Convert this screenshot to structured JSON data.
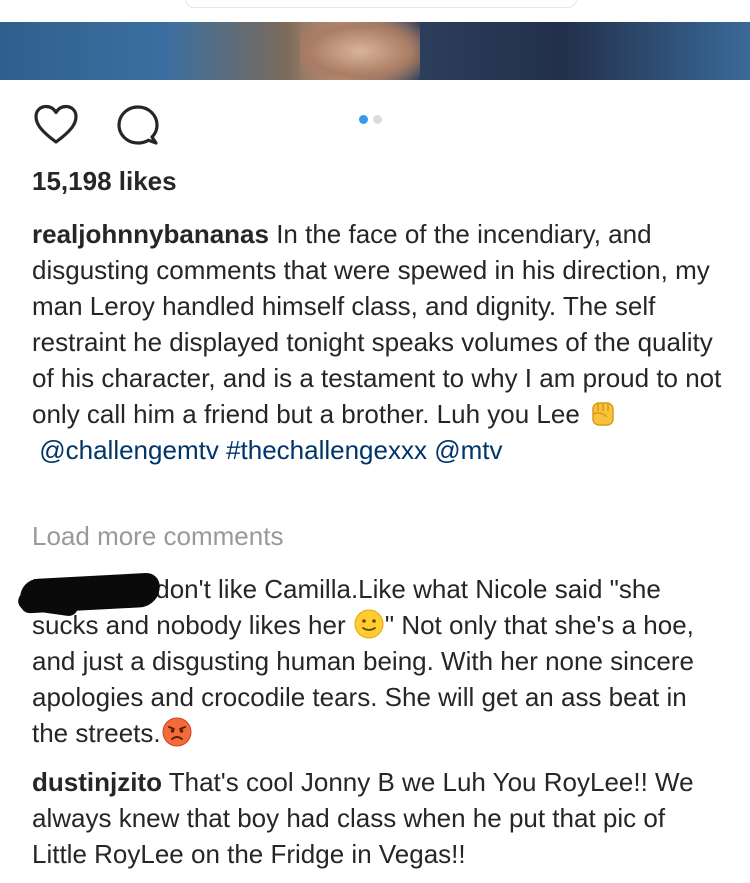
{
  "post": {
    "likes": "15,198 likes",
    "caption": {
      "username": "realjohnnybananas",
      "text": "In the face of the incendiary, and disgusting comments that were spewed in his direction, my man Leroy handled himself class, and dignity. The self restraint he displayed tonight speaks volumes of the quality of his character, and is a testament to why I am proud to not only call him a friend but a brother. Luh you Lee",
      "emoji": "raised-fist-emoji",
      "mention1": "@challengemtv",
      "hashtag": "#thechallengexxx",
      "mention2": "@mtv"
    },
    "carousel": {
      "count": 2,
      "active_index": 0,
      "active_color": "#3897f0",
      "inactive_color": "#dbdbdb"
    }
  },
  "load_more": "Load more comments",
  "comments": [
    {
      "username_redacted": "i",
      "text_part1": "don't like Camilla.Like what Nicole said \"she sucks and nobody likes her",
      "emoji1": "slightly-smiling-face-emoji",
      "text_part2": "\" Not only that she's a hoe, and just a disgusting human being. With her none sincere apologies and crocodile tears. She will get an ass beat in the streets.",
      "emoji2": "pouting-face-emoji"
    },
    {
      "username": "dustinjzito",
      "text": "That's cool Jonny B we Luh You RoyLee!! We always knew that boy had class when he put that pic of Little RoyLee on the Fridge in Vegas!!"
    }
  ],
  "colors": {
    "text": "#262626",
    "link": "#003569",
    "muted": "#999999"
  }
}
